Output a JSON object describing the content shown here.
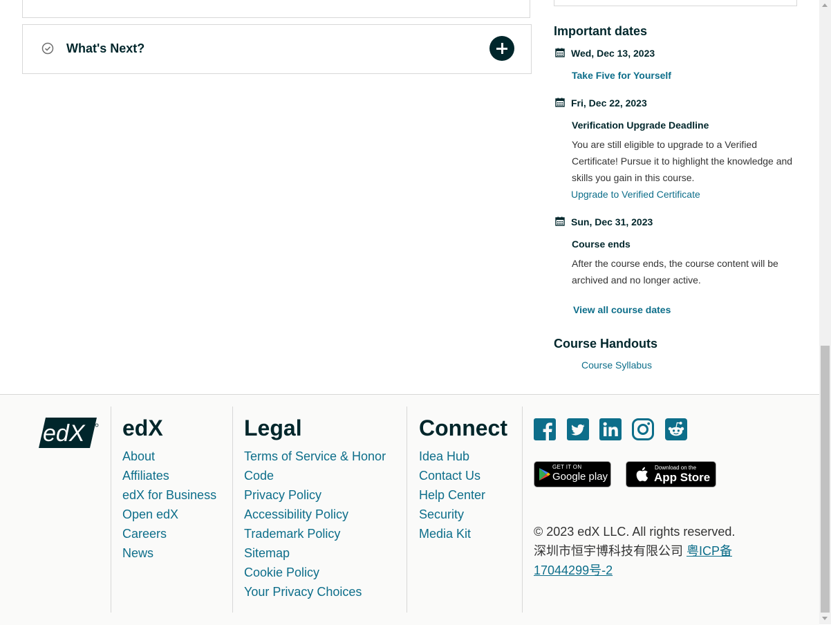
{
  "outline": {
    "section_title": "What's Next?"
  },
  "sidebar": {
    "important_dates_heading": "Important dates",
    "dates": [
      {
        "date": "Wed, Dec 13, 2023",
        "link": "Take Five for Yourself"
      },
      {
        "date": "Fri, Dec 22, 2023",
        "title": "Verification Upgrade Deadline",
        "description": "You are still eligible to upgrade to a Verified Certificate! Pursue it to highlight the knowledge and skills you gain in this course.",
        "link": "Upgrade to Verified Certificate"
      },
      {
        "date": "Sun, Dec 31, 2023",
        "title": "Course ends",
        "description": "After the course ends, the course content will be archived and no longer active."
      }
    ],
    "view_all_dates": "View all course dates",
    "handouts_heading": "Course Handouts",
    "handouts_link": "Course Syllabus"
  },
  "footer": {
    "logo_text": "edX",
    "edx_col": {
      "title": "edX",
      "links": [
        "About",
        "Affiliates",
        "edX for Business",
        "Open edX",
        "Careers",
        "News"
      ]
    },
    "legal_col": {
      "title": "Legal",
      "links": [
        "Terms of Service & Honor",
        "Code",
        "Privacy Policy",
        "Accessibility Policy",
        "Trademark Policy",
        "Sitemap",
        "Cookie Policy",
        "Your Privacy Choices"
      ]
    },
    "connect_col": {
      "title": "Connect",
      "links": [
        "Idea Hub",
        "Contact Us",
        "Help Center",
        "Security",
        "Media Kit"
      ]
    },
    "social_icons": [
      "facebook-icon",
      "twitter-icon",
      "linkedin-icon",
      "instagram-icon",
      "reddit-icon"
    ],
    "google_play": {
      "small": "GET IT ON",
      "big": "Google play"
    },
    "app_store": {
      "small": "Download on the",
      "big": "App Store"
    },
    "copyright": "© 2023 edX LLC. All rights reserved.",
    "icp_prefix": "深圳市恒宇博科技有限公司 ",
    "icp_link_line1": "粤ICP备",
    "icp_link_line2": "17044299号-2"
  },
  "colors": {
    "brand_dark": "#00262b",
    "link": "#0d6e8a",
    "border": "#d7d7d7",
    "footer_bg": "#fafaf9"
  }
}
